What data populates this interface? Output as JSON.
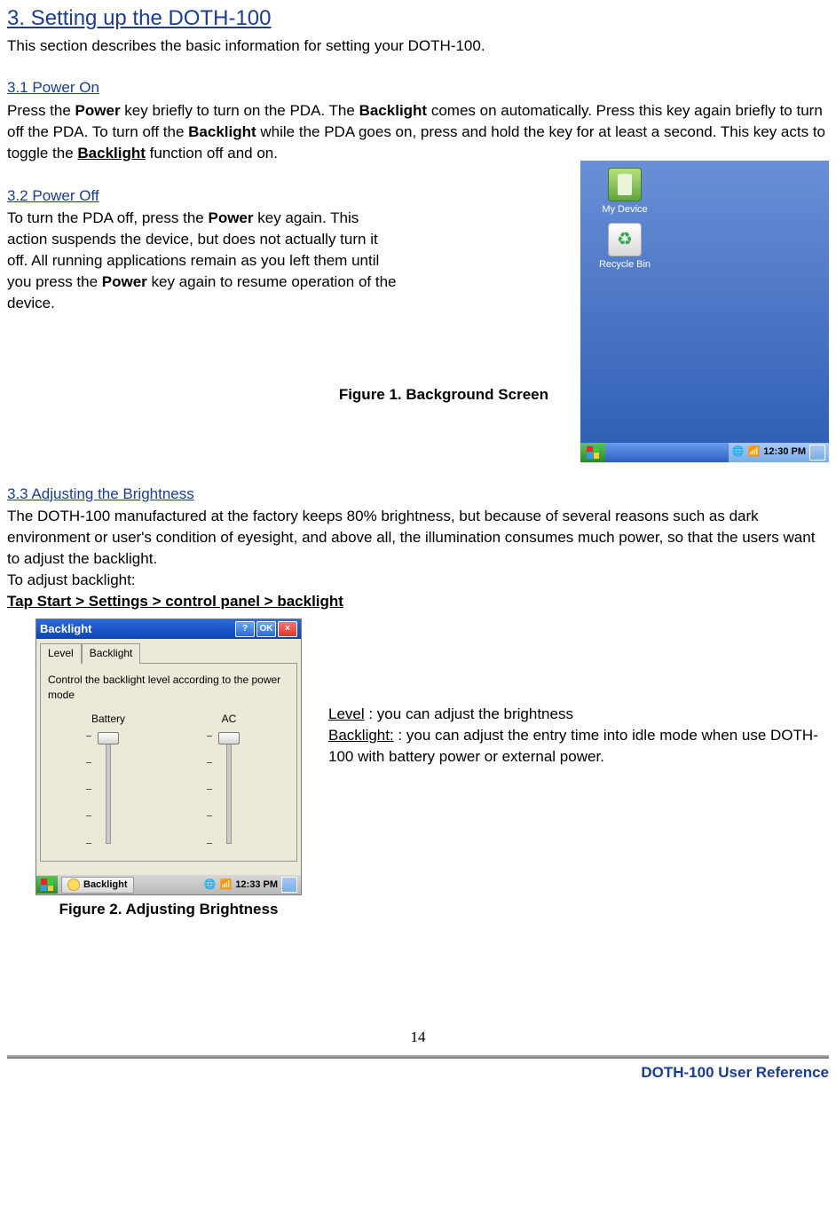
{
  "page": {
    "title": "3. Setting up the DOTH-100",
    "intro": "This section describes the basic information for setting your DOTH-100."
  },
  "section_3_1": {
    "heading": "3.1 Power On",
    "text_prefix": "Press the ",
    "power1": "Power",
    "text_mid1": " key briefly to turn on the PDA. The ",
    "backlight1": "Backlight",
    "text_mid2": " comes on automatically. Press this key again briefly to turn off the PDA. To turn off the ",
    "backlight2": "Backlight",
    "text_mid3": " while the PDA goes on, press and hold the key for at least a second. This key acts to toggle the ",
    "backlight3": "Backlight",
    "text_suffix": " function off and on."
  },
  "section_3_2": {
    "heading": "3.2 Power Off",
    "text_prefix": "To turn the PDA off, press the ",
    "power1": "Power",
    "text_mid1": " key again. This action suspends the device, but does not actually turn it off. All running applications remain as you left them until you press the ",
    "power2": "Power",
    "text_suffix": " key again to resume operation of the device."
  },
  "figure1": {
    "caption": "Figure 1. Background Screen",
    "icons": {
      "my_device": "My Device",
      "recycle_bin": "Recycle Bin"
    },
    "time": "12:30 PM"
  },
  "section_3_3": {
    "heading": "3.3 Adjusting the Brightness",
    "paragraph": "The DOTH-100 manufactured at the factory keeps 80% brightness, but because of several reasons such as dark environment or user's condition of eyesight, and above all, the illumination consumes much power, so that the users want to adjust the backlight.",
    "to_adjust": "To adjust backlight:",
    "path": "Tap Start > Settings > control panel > backlight"
  },
  "figure2": {
    "title": "Backlight",
    "tab_level": "Level",
    "tab_backlight": "Backlight",
    "help": "?",
    "ok": "OK",
    "close": "×",
    "body_text": "Control the backlight level according to the power mode",
    "col_battery": "Battery",
    "col_ac": "AC",
    "task_label": "Backlight",
    "time": "12:33 PM",
    "caption": "Figure 2. Adjusting Brightness"
  },
  "annotations": {
    "level_label": "Level",
    "level_text": " : you can adjust the brightness",
    "backlight_label": "Backlight:",
    "backlight_text": " : you can adjust the entry time into idle mode when use DOTH-100 with battery power or external power."
  },
  "footer": {
    "page_num": "14",
    "ref": "DOTH-100 User Reference"
  }
}
